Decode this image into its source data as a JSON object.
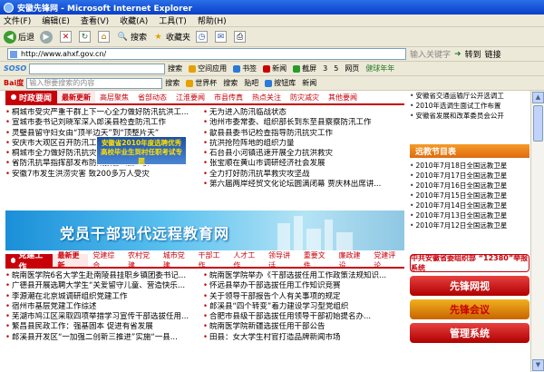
{
  "window": {
    "title": "安徽先锋网 - Microsoft Internet Explorer"
  },
  "menu": [
    "文件(F)",
    "编辑(E)",
    "查看(V)",
    "收藏(A)",
    "工具(T)",
    "帮助(H)"
  ],
  "toolbar": {
    "back": "后退",
    "search": "搜索",
    "favorites": "收藏夹"
  },
  "address": {
    "url": "http://www.ahxf.gov.cn/",
    "prompt": "输入关键字",
    "go": "转到",
    "links": "链接"
  },
  "soso": {
    "logo": "SOSO",
    "search": "搜索",
    "items": [
      "空间应用",
      "书签",
      "新闻",
      "截屏",
      "3",
      "5",
      "网页"
    ],
    "hint": "健球年年"
  },
  "baidu": {
    "logo": "Bai度",
    "search": "搜索",
    "placeholder": "输入想要搜索的内容",
    "items": [
      "世界杯",
      "搜索",
      "贴吧",
      "按钮库",
      "新闻"
    ]
  },
  "section1": {
    "head": "时政要闻",
    "tabs": [
      "最新更新",
      "高层聚焦",
      "省部动态",
      "江淮要闻",
      "市县传真",
      "热点关注",
      "防灾减灾",
      "其他要闻"
    ],
    "left": [
      "桐城市受灾严重干群上下一心全力做好防汛抗洪工...",
      "宣城市委书记刘晓军深入郎溪县检查防汛工作",
      "灵璧县留守妇女由“顶半边天”到“顶整片天”",
      "安庆市大观区召开防汛工作会议",
      "桐城市全力做好防汛抗灾工作",
      "省防汛抗旱指挥部发布防汛预警（第8号）",
      "安徽7市发生洪涝灾害 致200多万人受灾"
    ],
    "right": [
      "无为进入防汛临战状态",
      "池州市委常委、组织部长到东至县察察防汛工作",
      "歙县县委书记检查指导防汛抗灾工作",
      "抗洪抢险阵地的组织力量",
      "石台县小河镇迅速开展全力抗洪救灾",
      "张宝顺在黄山市调研经济社会发展",
      "全力打好防汛抗旱救灾攻坚战",
      "第六届两岸经贸文化论坛圆满闭幕 贾庆林出席讲..."
    ]
  },
  "overlay_banner": "安徽省2010年度选聘优秀高校毕业生到村任职考试专题",
  "edu_banner": "党员干部现代远程教育网",
  "section2": {
    "head": "党建工作",
    "tabs": [
      "最新更新",
      "党建综合",
      "农村党建",
      "城市党建",
      "干部工作",
      "人才工作",
      "领导讲话",
      "重要文件",
      "廉政建设",
      "党建评论"
    ],
    "left": [
      "皖南医学院6名大学生赴南陵县挂职乡镇团委书记...",
      "广德县开展选聘大学生“关爱留守儿童、营造快乐...",
      "李源潮在北京城调研组织党建工作",
      "宿州市基层党建工作综述",
      "芜湖市鸠江区采取四项举措学习宣传干部选拔任用...",
      "繁昌县民政工作：强基固本 促进有省发展",
      "郎溪县开发区“一加强二创新三推进”实施“一县..."
    ],
    "right": [
      "皖南医学院举办《干部选拔任用工作政策法规知识...",
      "怀远县举办干部选拔任用工作知识竞赛",
      "关于领导干部报告个人有关事项的规定",
      "郎溪县“四个转变”着力建设学习型党组织",
      "合肥市县级干部选拔任用领导干部初始提名办...",
      "皖南医学院新疆选拔任用干部公告",
      "田县：女大学生村官打造品牌新闻市场"
    ]
  },
  "sidebar": {
    "top": [
      "安徽省交通运输厅公开选调工",
      "2010年选调生面试工作布置",
      "安徽省发展和改革委员会公开"
    ],
    "head": "远教节目表",
    "items": [
      "2010年7月18日全国远教卫星",
      "2010年7月17日全国远教卫星",
      "2010年7月16日全国远教卫星",
      "2010年7月15日全国远教卫星",
      "2010年7月14日全国远教卫星",
      "2010年7月13日全国远教卫星",
      "2010年7月12日全国远教卫星"
    ],
    "report": "中共安徽省委组织部 “12380”举报系统",
    "ads": [
      "先锋网视",
      "先锋会议",
      "管理系统"
    ]
  }
}
